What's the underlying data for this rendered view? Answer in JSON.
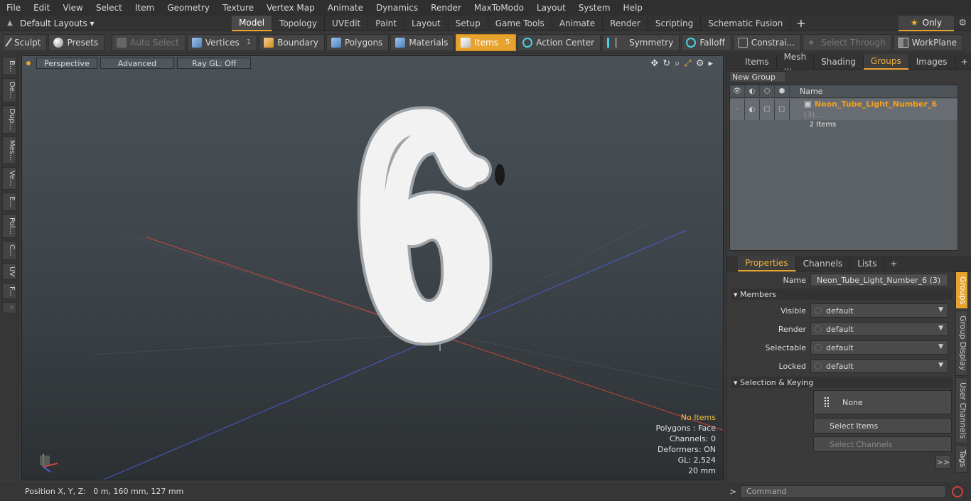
{
  "menu": [
    "File",
    "Edit",
    "View",
    "Select",
    "Item",
    "Geometry",
    "Texture",
    "Vertex Map",
    "Animate",
    "Dynamics",
    "Render",
    "MaxToModo",
    "Layout",
    "System",
    "Help"
  ],
  "layout_dropdown": "Default Layouts",
  "layout_tabs": [
    "Model",
    "Topology",
    "UVEdit",
    "Paint",
    "Layout",
    "Setup",
    "Game Tools",
    "Animate",
    "Render",
    "Scripting",
    "Schematic Fusion"
  ],
  "only_label": "Only",
  "toolbar": {
    "sculpt": "Sculpt",
    "presets": "Presets",
    "auto_select": "Auto Select",
    "vertices": "Vertices",
    "vertices_count": "1",
    "boundary": "Boundary",
    "polygons": "Polygons",
    "materials": "Materials",
    "items": "Items",
    "items_count": "5",
    "action_center": "Action Center",
    "symmetry": "Symmetry",
    "falloff": "Falloff",
    "constraints": "Constrai...",
    "select_through": "Select Through",
    "workplane": "WorkPlane"
  },
  "left_strip": [
    "B...",
    "De...",
    "Dup...",
    "Mes...",
    "Ve...",
    "E...",
    "Pol...",
    "C...",
    "UV",
    "F..."
  ],
  "viewport": {
    "view_mode": "Perspective",
    "advanced": "Advanced",
    "raygl": "Ray GL: Off",
    "info": {
      "items": "No Items",
      "polygons": "Polygons : Face",
      "channels": "Channels: 0",
      "deformers": "Deformers: ON",
      "gl": "GL: 2,524",
      "scale": "20 mm"
    }
  },
  "status": "Position X, Y, Z:   0 m, 160 mm, 127 mm",
  "groups_panel": {
    "tabs": [
      "Items",
      "Mesh ...",
      "Shading",
      "Groups",
      "Images"
    ],
    "new_group": "New Group",
    "col_name": "Name",
    "row_name": "Neon_Tube_Light_Number_6",
    "row_suffix": " (3)...",
    "row_sub": "2 Items"
  },
  "properties_panel": {
    "tabs": [
      "Properties",
      "Channels",
      "Lists"
    ],
    "name_label": "Name",
    "name_value": "Neon_Tube_Light_Number_6 (3)",
    "members": "Members",
    "visible_label": "Visible",
    "visible_value": "default",
    "render_label": "Render",
    "render_value": "default",
    "selectable_label": "Selectable",
    "selectable_value": "default",
    "locked_label": "Locked",
    "locked_value": "default",
    "selection_keying": "Selection & Keying",
    "none": "None",
    "select_items": "Select Items",
    "select_channels": "Select Channels",
    "more": ">>",
    "vtabs": [
      "Groups",
      "Group Display",
      "User Channels",
      "Tags"
    ]
  },
  "command_placeholder": "Command"
}
